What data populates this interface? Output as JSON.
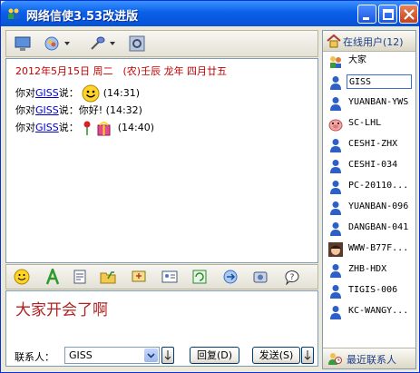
{
  "window": {
    "title": "网络信使3.53改进版"
  },
  "chat": {
    "date_line": "2012年5月15日 周二　(农)壬辰 龙年 四月廿五",
    "messages": [
      {
        "prefix": "你对",
        "user": "GISS",
        "suffix": "说：",
        "content": "",
        "emoticon": "smiley-icon",
        "time": "(14:31)"
      },
      {
        "prefix": "你对",
        "user": "GISS",
        "suffix": "说：",
        "content": "你好!",
        "emoticon": "",
        "time": "(14:32)"
      },
      {
        "prefix": "你对",
        "user": "GISS",
        "suffix": "说：",
        "content": "",
        "emoticon": "rose-gift-icon",
        "time": "(14:40)"
      }
    ]
  },
  "input": {
    "value": "大家开会了啊"
  },
  "bottom": {
    "contact_label": "联系人：",
    "contact_value": "GISS",
    "reply_label": "回复(D)",
    "send_label": "发送(S)"
  },
  "online": {
    "header": "在线用户(12)",
    "users": [
      {
        "name": "大家",
        "icon": "group-icon"
      },
      {
        "name": "GISS",
        "icon": "user-icon",
        "selected": true
      },
      {
        "name": "YUANBAN-YWS",
        "icon": "user-icon"
      },
      {
        "name": "SC-LHL",
        "icon": "pig-avatar-icon"
      },
      {
        "name": "CESHI-ZHX",
        "icon": "user-icon"
      },
      {
        "name": "CESHI-034",
        "icon": "user-icon"
      },
      {
        "name": "PC-20110...",
        "icon": "user-icon"
      },
      {
        "name": "YUANBAN-096",
        "icon": "user-icon"
      },
      {
        "name": "DANGBAN-041",
        "icon": "user-icon"
      },
      {
        "name": "WWW-B77F...",
        "icon": "face-avatar-icon"
      },
      {
        "name": "ZHB-HDX",
        "icon": "user-icon"
      },
      {
        "name": "TIGIS-006",
        "icon": "user-icon"
      },
      {
        "name": "KC-WANGY...",
        "icon": "user-icon"
      }
    ],
    "footer": "最近联系人"
  },
  "colors": {
    "title_blue": "#0A5FE8",
    "date_red": "#C00000",
    "input_red": "#B22222",
    "link_blue": "#0000CC"
  }
}
